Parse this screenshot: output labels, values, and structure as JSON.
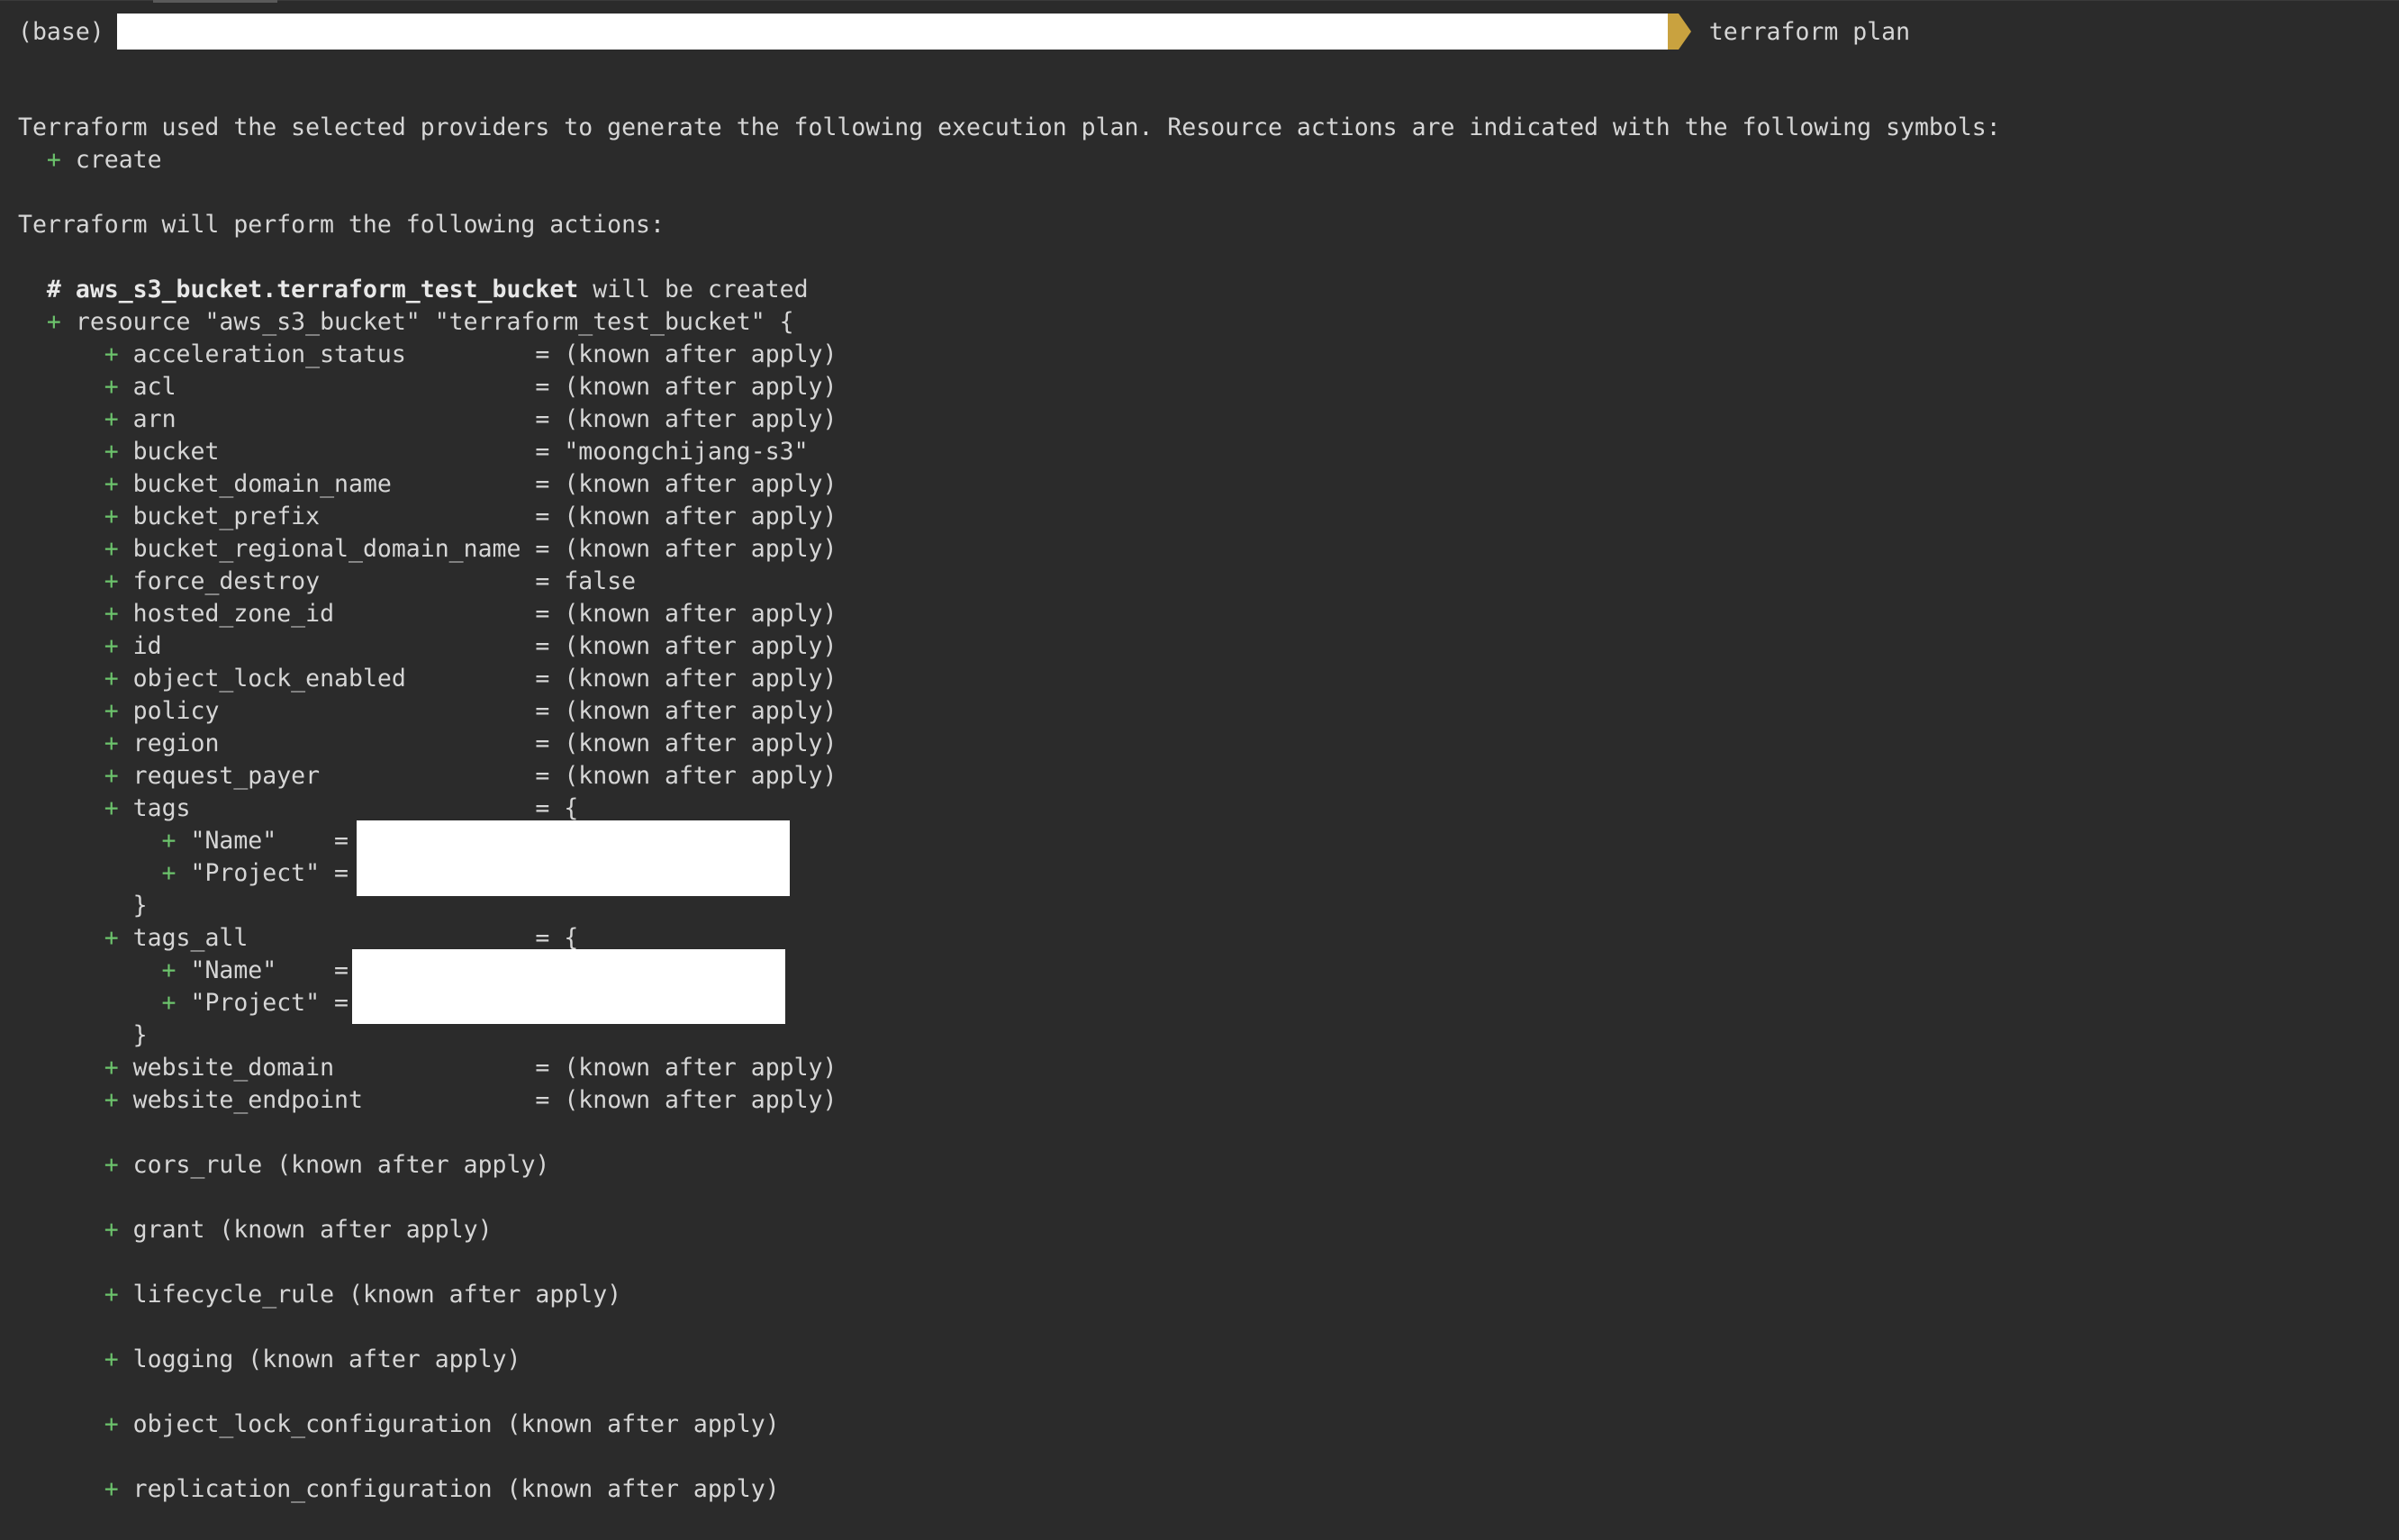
{
  "prompt": {
    "env": "(base)",
    "command": "terraform plan"
  },
  "output": {
    "intro": "Terraform used the selected providers to generate the following execution plan. Resource actions are indicated with the following symbols:",
    "legend_symbol": "+",
    "legend_label": "create",
    "actions_heading": "Terraform will perform the following actions:",
    "resource_comment_hash": "#",
    "resource_address": "aws_s3_bucket.terraform_test_bucket",
    "resource_comment_suffix": " will be created",
    "resource_decl": "resource \"aws_s3_bucket\" \"terraform_test_bucket\" {",
    "attributes": [
      {
        "key": "acceleration_status         ",
        "value": "(known after apply)"
      },
      {
        "key": "acl                         ",
        "value": "(known after apply)"
      },
      {
        "key": "arn                         ",
        "value": "(known after apply)"
      },
      {
        "key": "bucket                      ",
        "value": "\"moongchijang-s3\""
      },
      {
        "key": "bucket_domain_name          ",
        "value": "(known after apply)"
      },
      {
        "key": "bucket_prefix               ",
        "value": "(known after apply)"
      },
      {
        "key": "bucket_regional_domain_name ",
        "value": "(known after apply)"
      },
      {
        "key": "force_destroy               ",
        "value": "false"
      },
      {
        "key": "hosted_zone_id              ",
        "value": "(known after apply)"
      },
      {
        "key": "id                          ",
        "value": "(known after apply)"
      },
      {
        "key": "object_lock_enabled         ",
        "value": "(known after apply)"
      },
      {
        "key": "policy                      ",
        "value": "(known after apply)"
      },
      {
        "key": "region                      ",
        "value": "(known after apply)"
      },
      {
        "key": "request_payer               ",
        "value": "(known after apply)"
      }
    ],
    "tags": {
      "key": "tags                        ",
      "open": "{",
      "entries": [
        "\"Name\"    =",
        "\"Project\" ="
      ],
      "close": "}"
    },
    "tags_all": {
      "key": "tags_all                    ",
      "open": "{",
      "entries": [
        "\"Name\"    =",
        "\"Project\" ="
      ],
      "close": "}"
    },
    "attributes_after": [
      {
        "key": "website_domain              ",
        "value": "(known after apply)"
      },
      {
        "key": "website_endpoint            ",
        "value": "(known after apply)"
      }
    ],
    "blocks": [
      "cors_rule (known after apply)",
      "grant (known after apply)",
      "lifecycle_rule (known after apply)",
      "logging (known after apply)",
      "object_lock_configuration (known after apply)",
      "replication_configuration (known after apply)"
    ]
  }
}
